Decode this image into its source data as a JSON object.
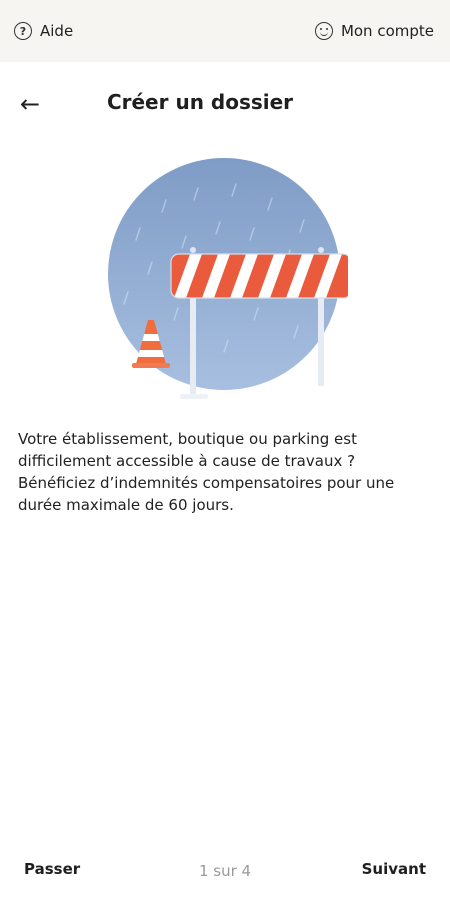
{
  "topbar": {
    "help": {
      "icon": "question-circle-icon",
      "label": "Aide"
    },
    "account": {
      "icon": "smiley-user-icon",
      "label": "Mon compte"
    }
  },
  "header": {
    "back_icon": "arrow-left-icon",
    "title": "Créer un dossier"
  },
  "illustration": {
    "subject": "road-barrier-and-cone-in-rain",
    "colors": {
      "sky": "#8fa9cf",
      "barrier_red": "#ea5a3c",
      "barrier_white": "#ffffff",
      "cone_orange": "#f06d3d"
    }
  },
  "content": {
    "description": "Votre établissement, boutique ou parking est difficilement accessible à cause de travaux ? Bénéficiez d’indemnités compensatoires pour une durée maximale de 60 jours."
  },
  "footer": {
    "skip_label": "Passer",
    "progress": "1 sur 4",
    "next_label": "Suivant"
  }
}
